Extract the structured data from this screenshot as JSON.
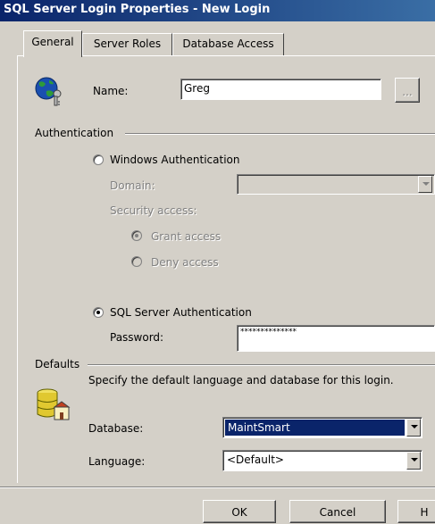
{
  "window": {
    "title": "SQL Server Login Properties - New Login"
  },
  "tabs": [
    {
      "label": "General",
      "active": true
    },
    {
      "label": "Server Roles",
      "active": false
    },
    {
      "label": "Database Access",
      "active": false
    }
  ],
  "login": {
    "name_label": "Name:",
    "name_value": "Greg",
    "browse_label": "...",
    "icon": "login-globe-key-icon"
  },
  "authentication": {
    "group_label": "Authentication",
    "windows": {
      "label": "Windows Authentication",
      "selected": false,
      "domain_label": "Domain:",
      "domain_value": "",
      "security_label": "Security access:",
      "grant_label": "Grant access",
      "grant_selected": true,
      "deny_label": "Deny access",
      "deny_selected": false
    },
    "sql": {
      "label": "SQL Server Authentication",
      "selected": true,
      "password_label": "Password:",
      "password_value": "**************"
    }
  },
  "defaults": {
    "group_label": "Defaults",
    "description": "Specify the default language and database for this login.",
    "icon": "database-defaults-icon",
    "database_label": "Database:",
    "database_value": "MaintSmart",
    "language_label": "Language:",
    "language_value": "<Default>"
  },
  "buttons": {
    "ok": "OK",
    "cancel": "Cancel",
    "help": "H"
  },
  "colors": {
    "title_start": "#0a246a",
    "title_end": "#3a6ea5",
    "face": "#d4d0c8",
    "selection": "#0a246a"
  }
}
